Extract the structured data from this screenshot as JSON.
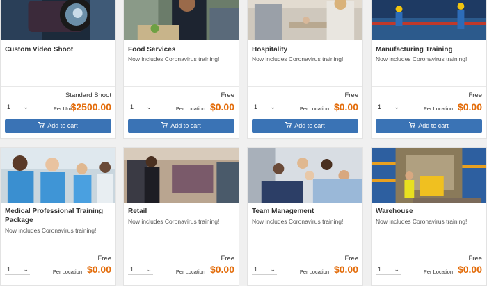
{
  "products": [
    {
      "title": "Custom Video Shoot",
      "subtitle": "",
      "price_type": "Standard Shoot",
      "qty": "1",
      "per_label": "Per Unit",
      "price": "$2500.00",
      "button": "Add to cart",
      "image": "video-camera"
    },
    {
      "title": "Food Services",
      "subtitle": "Now includes Coronavirus training!",
      "price_type": "Free",
      "qty": "1",
      "per_label": "Per Location",
      "price": "$0.00",
      "button": "Add to cart",
      "image": "chef-kitchen"
    },
    {
      "title": "Hospitality",
      "subtitle": "Now includes Coronavirus training!",
      "price_type": "Free",
      "qty": "1",
      "per_label": "Per Location",
      "price": "$0.00",
      "button": "Add to cart",
      "image": "handshake-lobby"
    },
    {
      "title": "Manufacturing Training",
      "subtitle": "Now includes Coronavirus training!",
      "price_type": "Free",
      "qty": "1",
      "per_label": "Per Location",
      "price": "$0.00",
      "button": "Add to cart",
      "image": "factory-workers"
    },
    {
      "title": "Medical Professional Training Package",
      "subtitle": "Now includes Coronavirus training!",
      "price_type": "Free",
      "qty": "1",
      "per_label": "Per Location",
      "price": "$0.00",
      "button": "",
      "image": "medical-staff"
    },
    {
      "title": "Retail",
      "subtitle": "Now includes Coronavirus training!",
      "price_type": "Free",
      "qty": "1",
      "per_label": "Per Location",
      "price": "$0.00",
      "button": "",
      "image": "clothing-store"
    },
    {
      "title": "Team Management",
      "subtitle": "Now includes Coronavirus training!",
      "price_type": "Free",
      "qty": "1",
      "per_label": "Per Location",
      "price": "$0.00",
      "button": "",
      "image": "team-huddle"
    },
    {
      "title": "Warehouse",
      "subtitle": "Now includes Coronavirus training!",
      "price_type": "Free",
      "qty": "1",
      "per_label": "Per Location",
      "price": "$0.00",
      "button": "",
      "image": "warehouse-forklift"
    }
  ],
  "colors": {
    "accent": "#3a73b5",
    "price": "#e36c0a",
    "background": "#f0f0f0"
  }
}
